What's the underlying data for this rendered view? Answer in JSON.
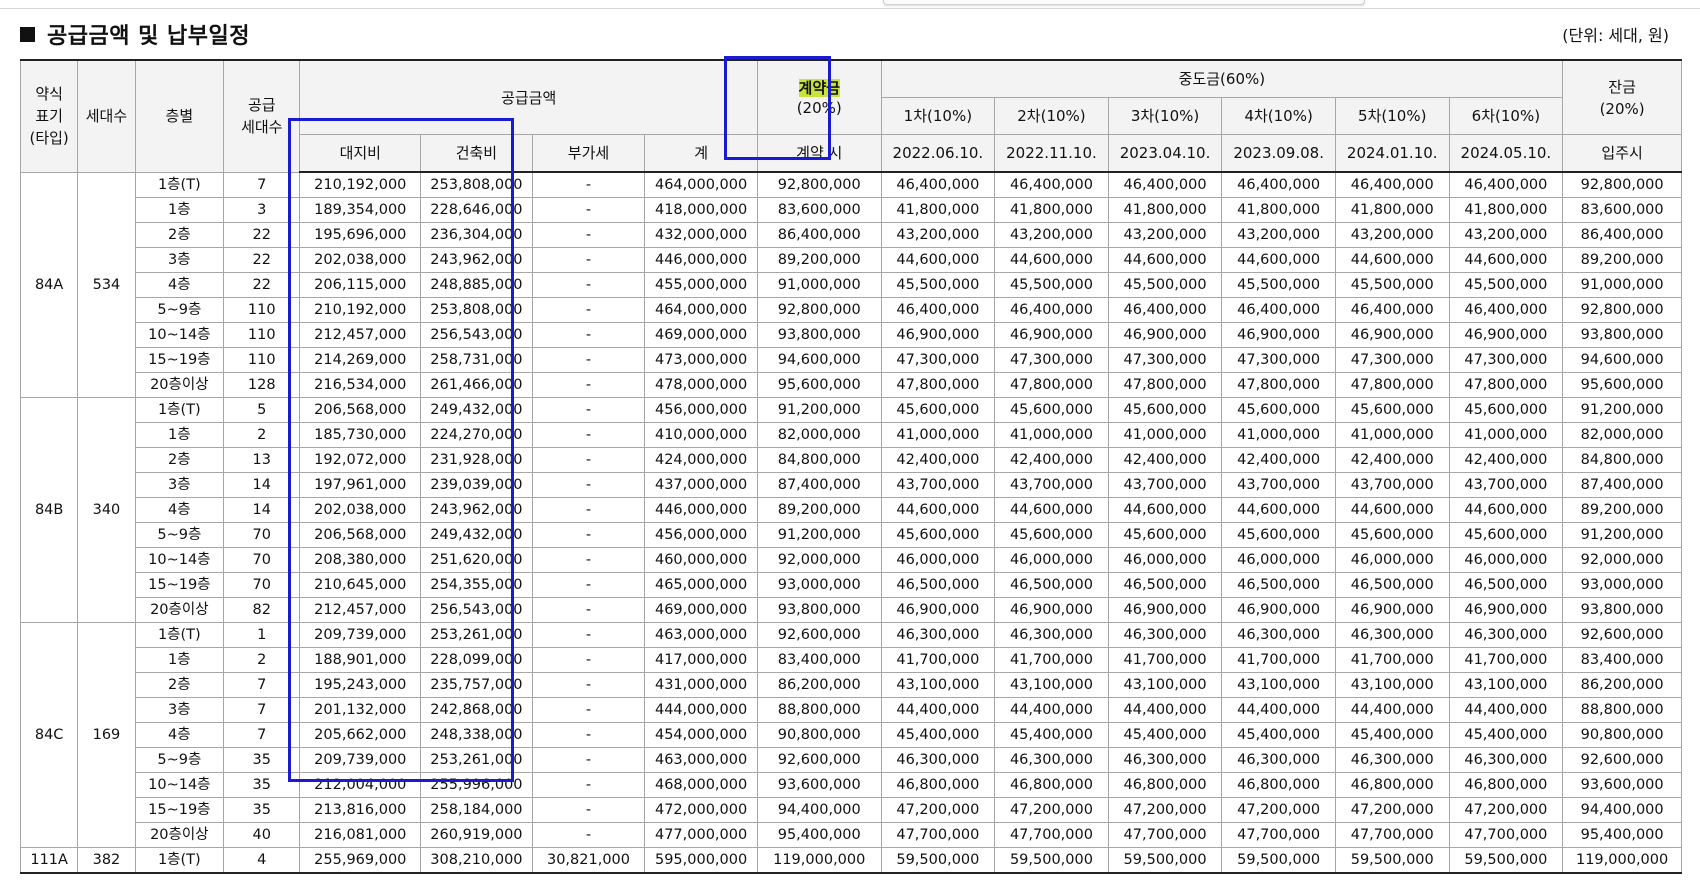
{
  "title": "공급금액 및 납부일정",
  "unit": "(단위: 세대, 원)",
  "headers": {
    "type": "약식\n표기\n(타입)",
    "households": "세대수",
    "floor": "층별",
    "supply_households": "공급\n세대수",
    "supply_amount": "공급금액",
    "land": "대지비",
    "building": "건축비",
    "vat": "부가세",
    "total": "계",
    "deposit_label": "계약금",
    "deposit_pct": "(20%)",
    "deposit_when": "계약 시",
    "middle": "중도금(60%)",
    "installments": [
      {
        "label": "1차(10%)",
        "date": "2022.06.10."
      },
      {
        "label": "2차(10%)",
        "date": "2022.11.10."
      },
      {
        "label": "3차(10%)",
        "date": "2023.04.10."
      },
      {
        "label": "4차(10%)",
        "date": "2023.09.08."
      },
      {
        "label": "5차(10%)",
        "date": "2024.01.10."
      },
      {
        "label": "6차(10%)",
        "date": "2024.05.10."
      }
    ],
    "balance": "잔금\n(20%)",
    "balance_when": "입주시"
  },
  "groups": [
    {
      "type": "84A",
      "households": "534",
      "rows": [
        [
          "1층(T)",
          "7",
          "210,192,000",
          "253,808,000",
          "-",
          "464,000,000",
          "92,800,000",
          "46,400,000",
          "92,800,000"
        ],
        [
          "1층",
          "3",
          "189,354,000",
          "228,646,000",
          "-",
          "418,000,000",
          "83,600,000",
          "41,800,000",
          "83,600,000"
        ],
        [
          "2층",
          "22",
          "195,696,000",
          "236,304,000",
          "-",
          "432,000,000",
          "86,400,000",
          "43,200,000",
          "86,400,000"
        ],
        [
          "3층",
          "22",
          "202,038,000",
          "243,962,000",
          "-",
          "446,000,000",
          "89,200,000",
          "44,600,000",
          "89,200,000"
        ],
        [
          "4층",
          "22",
          "206,115,000",
          "248,885,000",
          "-",
          "455,000,000",
          "91,000,000",
          "45,500,000",
          "91,000,000"
        ],
        [
          "5~9층",
          "110",
          "210,192,000",
          "253,808,000",
          "-",
          "464,000,000",
          "92,800,000",
          "46,400,000",
          "92,800,000"
        ],
        [
          "10~14층",
          "110",
          "212,457,000",
          "256,543,000",
          "-",
          "469,000,000",
          "93,800,000",
          "46,900,000",
          "93,800,000"
        ],
        [
          "15~19층",
          "110",
          "214,269,000",
          "258,731,000",
          "-",
          "473,000,000",
          "94,600,000",
          "47,300,000",
          "94,600,000"
        ],
        [
          "20층이상",
          "128",
          "216,534,000",
          "261,466,000",
          "-",
          "478,000,000",
          "95,600,000",
          "47,800,000",
          "95,600,000"
        ]
      ]
    },
    {
      "type": "84B",
      "households": "340",
      "rows": [
        [
          "1층(T)",
          "5",
          "206,568,000",
          "249,432,000",
          "-",
          "456,000,000",
          "91,200,000",
          "45,600,000",
          "91,200,000"
        ],
        [
          "1층",
          "2",
          "185,730,000",
          "224,270,000",
          "-",
          "410,000,000",
          "82,000,000",
          "41,000,000",
          "82,000,000"
        ],
        [
          "2층",
          "13",
          "192,072,000",
          "231,928,000",
          "-",
          "424,000,000",
          "84,800,000",
          "42,400,000",
          "84,800,000"
        ],
        [
          "3층",
          "14",
          "197,961,000",
          "239,039,000",
          "-",
          "437,000,000",
          "87,400,000",
          "43,700,000",
          "87,400,000"
        ],
        [
          "4층",
          "14",
          "202,038,000",
          "243,962,000",
          "-",
          "446,000,000",
          "89,200,000",
          "44,600,000",
          "89,200,000"
        ],
        [
          "5~9층",
          "70",
          "206,568,000",
          "249,432,000",
          "-",
          "456,000,000",
          "91,200,000",
          "45,600,000",
          "91,200,000"
        ],
        [
          "10~14층",
          "70",
          "208,380,000",
          "251,620,000",
          "-",
          "460,000,000",
          "92,000,000",
          "46,000,000",
          "92,000,000"
        ],
        [
          "15~19층",
          "70",
          "210,645,000",
          "254,355,000",
          "-",
          "465,000,000",
          "93,000,000",
          "46,500,000",
          "93,000,000"
        ],
        [
          "20층이상",
          "82",
          "212,457,000",
          "256,543,000",
          "-",
          "469,000,000",
          "93,800,000",
          "46,900,000",
          "93,800,000"
        ]
      ]
    },
    {
      "type": "84C",
      "households": "169",
      "rows": [
        [
          "1층(T)",
          "1",
          "209,739,000",
          "253,261,000",
          "-",
          "463,000,000",
          "92,600,000",
          "46,300,000",
          "92,600,000"
        ],
        [
          "1층",
          "2",
          "188,901,000",
          "228,099,000",
          "-",
          "417,000,000",
          "83,400,000",
          "41,700,000",
          "83,400,000"
        ],
        [
          "2층",
          "7",
          "195,243,000",
          "235,757,000",
          "-",
          "431,000,000",
          "86,200,000",
          "43,100,000",
          "86,200,000"
        ],
        [
          "3층",
          "7",
          "201,132,000",
          "242,868,000",
          "-",
          "444,000,000",
          "88,800,000",
          "44,400,000",
          "88,800,000"
        ],
        [
          "4층",
          "7",
          "205,662,000",
          "248,338,000",
          "-",
          "454,000,000",
          "90,800,000",
          "45,400,000",
          "90,800,000"
        ],
        [
          "5~9층",
          "35",
          "209,739,000",
          "253,261,000",
          "-",
          "463,000,000",
          "92,600,000",
          "46,300,000",
          "92,600,000"
        ],
        [
          "10~14층",
          "35",
          "212,004,000",
          "255,996,000",
          "-",
          "468,000,000",
          "93,600,000",
          "46,800,000",
          "93,600,000"
        ],
        [
          "15~19층",
          "35",
          "213,816,000",
          "258,184,000",
          "-",
          "472,000,000",
          "94,400,000",
          "47,200,000",
          "94,400,000"
        ],
        [
          "20층이상",
          "40",
          "216,081,000",
          "260,919,000",
          "-",
          "477,000,000",
          "95,400,000",
          "47,700,000",
          "95,400,000"
        ]
      ]
    },
    {
      "type": "111A",
      "households": "382",
      "rows": [
        [
          "1층(T)",
          "4",
          "255,969,000",
          "308,210,000",
          "30,821,000",
          "595,000,000",
          "119,000,000",
          "59,500,000",
          "119,000,000"
        ]
      ]
    }
  ],
  "highlight_color": "#c8e33a",
  "box_color": "#1a1ad0"
}
